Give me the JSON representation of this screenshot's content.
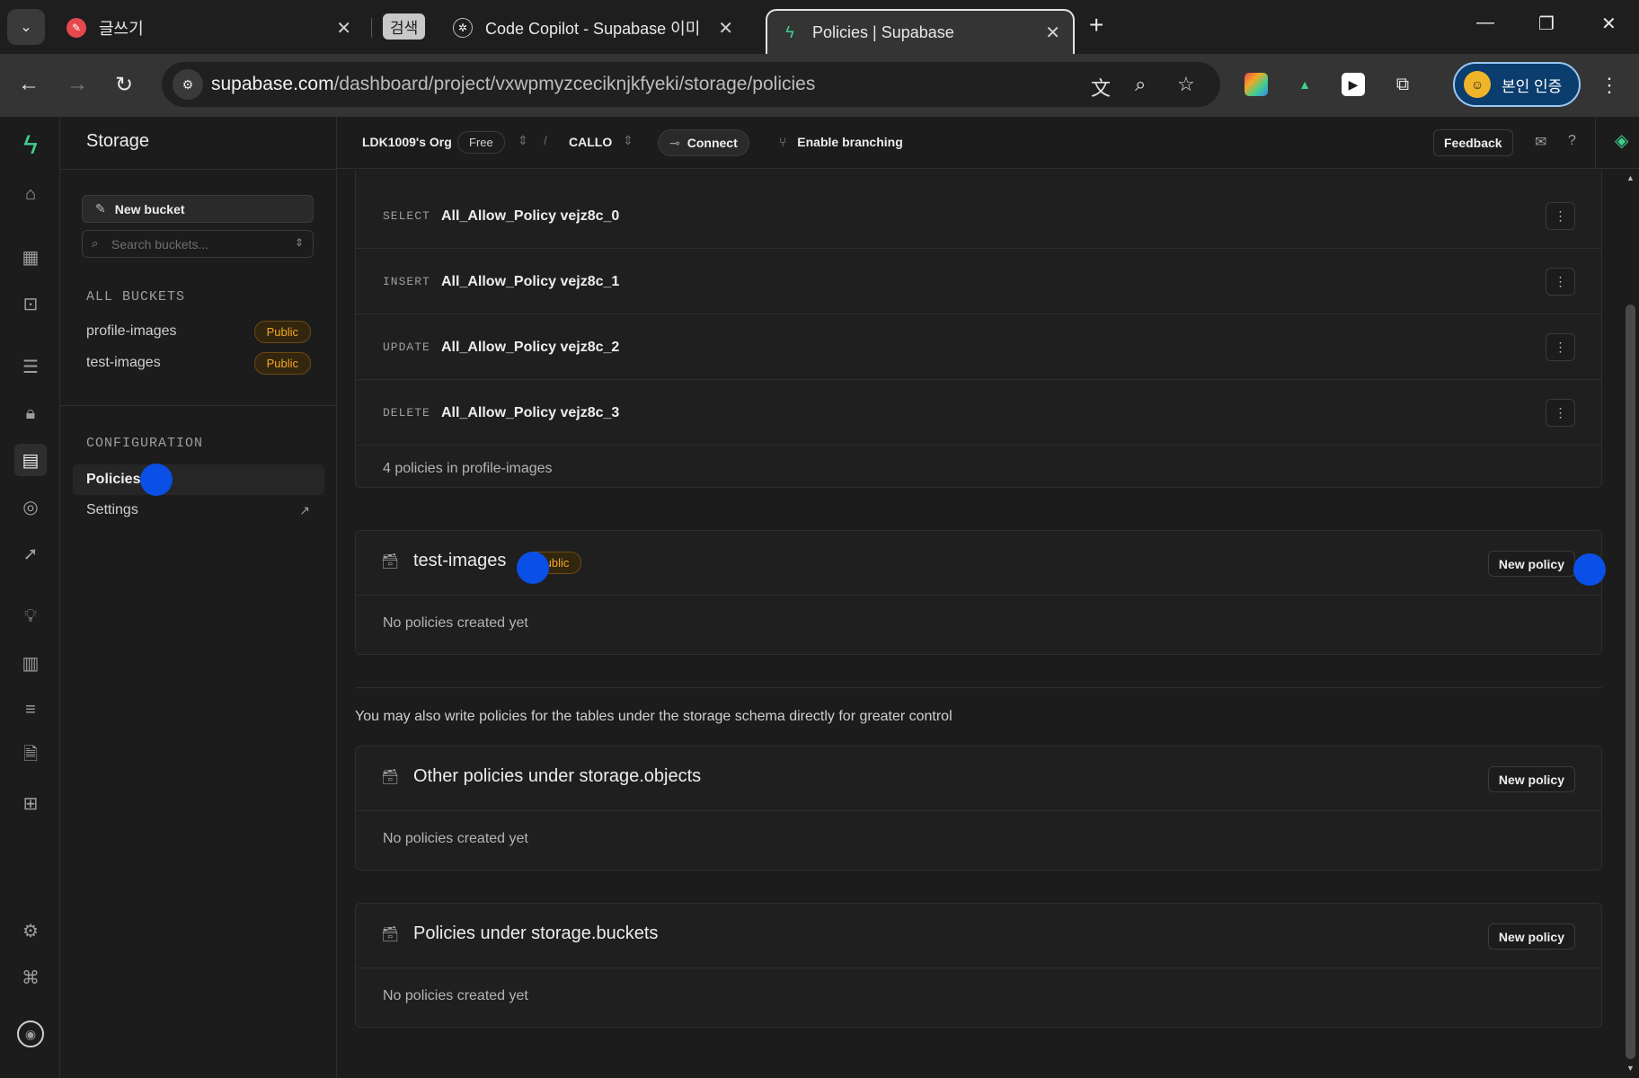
{
  "browser": {
    "tabs": [
      {
        "title": "글쓰기",
        "active": false
      },
      {
        "title": "Code Copilot - Supabase 이미",
        "active": false,
        "group_label": "검색"
      },
      {
        "title": "Policies | Supabase",
        "active": true
      }
    ],
    "url_host": "supabase.com",
    "url_path": "/dashboard/project/vxwpmyzceciknjkfyeki/storage/policies",
    "profile_label": "본인 인증"
  },
  "projbar": {
    "org": "LDK1009's Org",
    "plan": "Free",
    "separator": "/",
    "project": "CALLO",
    "connect_label": "Connect",
    "branching_label": "Enable branching",
    "feedback_label": "Feedback"
  },
  "sidebar": {
    "title": "Storage",
    "new_bucket_label": "New bucket",
    "search_placeholder": "Search buckets...",
    "all_buckets_heading": "ALL BUCKETS",
    "buckets": [
      {
        "name": "profile-images",
        "badge": "Public"
      },
      {
        "name": "test-images",
        "badge": "Public"
      }
    ],
    "configuration_heading": "CONFIGURATION",
    "config_items": [
      {
        "label": "Policies",
        "active": true
      },
      {
        "label": "Settings",
        "active": false
      }
    ]
  },
  "main": {
    "policies": [
      {
        "command": "SELECT",
        "name": "All_Allow_Policy vejz8c_0"
      },
      {
        "command": "INSERT",
        "name": "All_Allow_Policy vejz8c_1"
      },
      {
        "command": "UPDATE",
        "name": "All_Allow_Policy vejz8c_2"
      },
      {
        "command": "DELETE",
        "name": "All_Allow_Policy vejz8c_3"
      }
    ],
    "policy_count_text": "4 policies in profile-images",
    "test_bucket": {
      "title": "test-images",
      "badge": "Public",
      "new_policy_label": "New policy",
      "empty_text": "No policies created yet"
    },
    "hint_text": "You may also write policies for the tables under the storage schema directly for greater control",
    "objects_section": {
      "title": "Other policies under storage.objects",
      "new_policy_label": "New policy",
      "empty_text": "No policies created yet"
    },
    "buckets_section": {
      "title": "Policies under storage.buckets",
      "new_policy_label": "New policy",
      "empty_text": "No policies created yet"
    }
  },
  "colors": {
    "brand": "#3ecf8e",
    "public_badge": "#f5a623",
    "background": "#1c1c1c",
    "marker": "#0a4fe6"
  }
}
